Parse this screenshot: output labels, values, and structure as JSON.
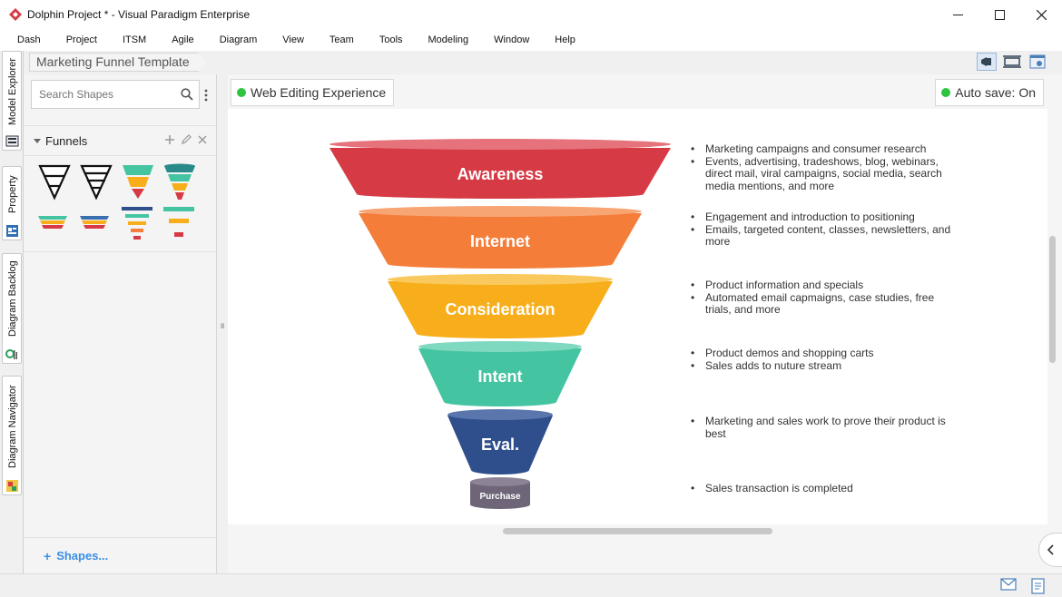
{
  "window": {
    "title": "Dolphin Project * - Visual Paradigm Enterprise",
    "controls": [
      "minimize-icon",
      "maximize-icon",
      "close-icon"
    ]
  },
  "menu": [
    "Dash",
    "Project",
    "ITSM",
    "Agile",
    "Diagram",
    "View",
    "Team",
    "Tools",
    "Modeling",
    "Window",
    "Help"
  ],
  "side_tabs": [
    "Model Explorer",
    "Property",
    "Diagram Backlog",
    "Diagram Navigator"
  ],
  "breadcrumb": "Marketing Funnel Template",
  "shapes_panel": {
    "search_placeholder": "Search Shapes",
    "category": "Funnels",
    "footer_link": "Shapes..."
  },
  "status": {
    "web_editing": "Web Editing Experience",
    "auto_save": "Auto save: On",
    "indicator_color": "#2ec440"
  },
  "funnel": [
    {
      "label": "Awareness",
      "color": "#d63a45"
    },
    {
      "label": "Internet",
      "color": "#f47d3a"
    },
    {
      "label": "Consideration",
      "color": "#f7ae1a"
    },
    {
      "label": "Intent",
      "color": "#45c4a2"
    },
    {
      "label": "Eval.",
      "color": "#2f4f8c"
    },
    {
      "label": "Purchase",
      "color": "#6e6678"
    }
  ],
  "descriptions": [
    [
      "Marketing campaigns and consumer research",
      "Events, advertising, tradeshows, blog, webinars, direct mail, viral campaigns, social media, search media mentions, and more"
    ],
    [
      "Engagement and introduction to positioning",
      "Emails, targeted content, classes, newsletters, and more"
    ],
    [
      "Product information and specials",
      "Automated email capmaigns, case studies, free trials, and more"
    ],
    [
      "Product demos and shopping carts",
      "Sales adds to nuture stream"
    ],
    [
      "Marketing and sales work to prove their product is best"
    ],
    [
      "Sales transaction is completed"
    ]
  ]
}
